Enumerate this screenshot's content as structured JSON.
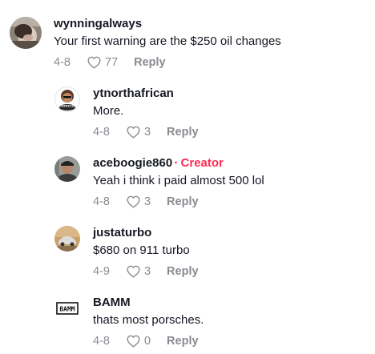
{
  "comments": [
    {
      "username": "wynningalways",
      "creator_label": "",
      "text": "Your first warning are the $250 oil changes",
      "date": "4-8",
      "likes": "77",
      "reply_label": "Reply",
      "avatar_icon": "photo-avatar"
    },
    {
      "username": "ytnorthafrican",
      "creator_label": "",
      "text": "More.",
      "date": "4-8",
      "likes": "3",
      "reply_label": "Reply",
      "avatar_icon": "cartoon-avatar",
      "avatar_caption": "Moroccan"
    },
    {
      "username": "aceboogie860",
      "creator_label": "Creator",
      "text": "Yeah i think i paid almost 500 lol",
      "date": "4-8",
      "likes": "3",
      "reply_label": "Reply",
      "avatar_icon": "photo-avatar"
    },
    {
      "username": "justaturbo",
      "creator_label": "",
      "text": "$680 on 911 turbo",
      "date": "4-9",
      "likes": "3",
      "reply_label": "Reply",
      "avatar_icon": "car-photo-avatar"
    },
    {
      "username": "BAMM",
      "creator_label": "",
      "text": "thats most porsches.",
      "date": "4-8",
      "likes": "0",
      "reply_label": "Reply",
      "avatar_icon": "logo-avatar",
      "avatar_logo_text": "BAMM"
    }
  ],
  "colors": {
    "text_primary": "#161823",
    "text_secondary": "#8a8b91",
    "creator_accent": "#fe2c55"
  }
}
